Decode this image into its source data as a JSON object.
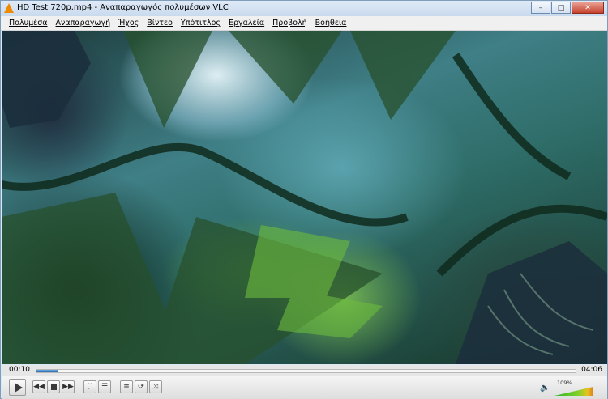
{
  "window": {
    "title": "HD Test 720p.mp4 - Αναπαραγωγός πολυμέσων VLC",
    "icon": "vlc-cone-icon",
    "buttons": {
      "minimize": "–",
      "maximize": "□",
      "close": "✕"
    }
  },
  "menu": [
    "Πολυμέσα",
    "Αναπαραγωγή",
    "Ήχος",
    "Βίντεο",
    "Υπότιτλος",
    "Εργαλεία",
    "Προβολή",
    "Βοήθεια"
  ],
  "video": {
    "content": "jungle-forest-video-frame"
  },
  "seek": {
    "elapsed": "00:10",
    "total": "04:06",
    "progress_fraction": 0.041
  },
  "controls": {
    "play": "play-icon",
    "previous": "◀◀",
    "stop": "stop-icon",
    "next": "▶▶",
    "fullscreen": "⛶",
    "extended": "☰",
    "playlist": "≡",
    "loop": "⟳",
    "shuffle": "⤨"
  },
  "volume": {
    "label": "109%",
    "icon": "🔈",
    "fraction": 1.0
  }
}
